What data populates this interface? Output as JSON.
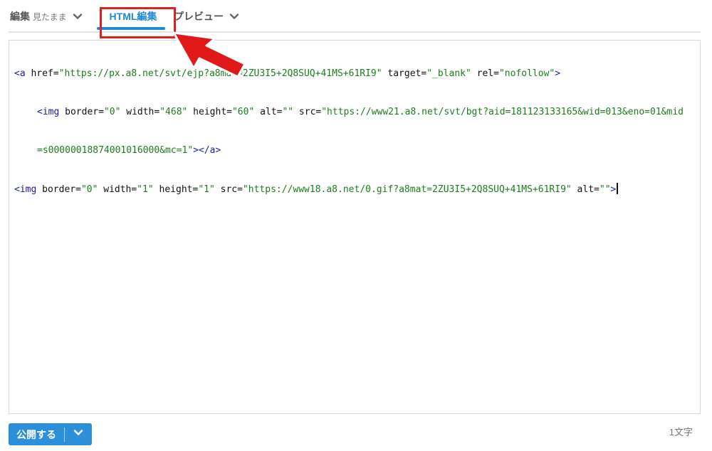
{
  "tabs": {
    "edit_label": "編集",
    "edit_mode": "見たまま",
    "html_label": "HTML編集",
    "preview_label": "プレビュー"
  },
  "code": {
    "line1": [
      {
        "t": "tag",
        "v": "<a "
      },
      {
        "t": "attr",
        "v": "href="
      },
      {
        "t": "str",
        "v": "\"https://px.a8.net/svt/ejp?a8mat=2ZU3I5+2Q8SUQ+41MS+61RI9\""
      },
      {
        "t": "attr",
        "v": " target="
      },
      {
        "t": "str",
        "v": "\"_blank\""
      },
      {
        "t": "attr",
        "v": " rel="
      },
      {
        "t": "str",
        "v": "\"nofollow\""
      },
      {
        "t": "tag",
        "v": ">"
      }
    ],
    "line2": [
      {
        "t": "tag",
        "v": "<img "
      },
      {
        "t": "attr",
        "v": "border="
      },
      {
        "t": "str",
        "v": "\"0\""
      },
      {
        "t": "attr",
        "v": " width="
      },
      {
        "t": "str",
        "v": "\"468\""
      },
      {
        "t": "attr",
        "v": " height="
      },
      {
        "t": "str",
        "v": "\"60\""
      },
      {
        "t": "attr",
        "v": " alt="
      },
      {
        "t": "str",
        "v": "\"\""
      },
      {
        "t": "attr",
        "v": " src="
      },
      {
        "t": "str",
        "v": "\"https://www21.a8.net/svt/bgt?aid=181123133165&wid=013&eno=01&mid"
      }
    ],
    "line3": [
      {
        "t": "str",
        "v": "=s00000018874001016000&mc=1\""
      },
      {
        "t": "tag",
        "v": "></a>"
      }
    ],
    "line4": [
      {
        "t": "tag",
        "v": "<img "
      },
      {
        "t": "attr",
        "v": "border="
      },
      {
        "t": "str",
        "v": "\"0\""
      },
      {
        "t": "attr",
        "v": " width="
      },
      {
        "t": "str",
        "v": "\"1\""
      },
      {
        "t": "attr",
        "v": " height="
      },
      {
        "t": "str",
        "v": "\"1\""
      },
      {
        "t": "attr",
        "v": " src="
      },
      {
        "t": "str",
        "v": "\"https://www18.a8.net/0.gif?a8mat=2ZU3I5+2Q8SUQ+41MS+61RI9\""
      },
      {
        "t": "attr",
        "v": " alt="
      },
      {
        "t": "str",
        "v": "\"\""
      },
      {
        "t": "tag",
        "v": ">"
      }
    ]
  },
  "footer": {
    "publish_label": "公開する",
    "char_count": "1文字"
  },
  "icons": {
    "tab_chevron": "chevron-down-icon",
    "publish_dropdown": "chevron-down-icon",
    "annotation": "red-arrow"
  },
  "colors": {
    "accent": "#1f8bd6",
    "button": "#2b8fd9",
    "highlight": "#e02020",
    "code_tag": "#1a1aa6",
    "code_string": "#1a7f1a"
  }
}
